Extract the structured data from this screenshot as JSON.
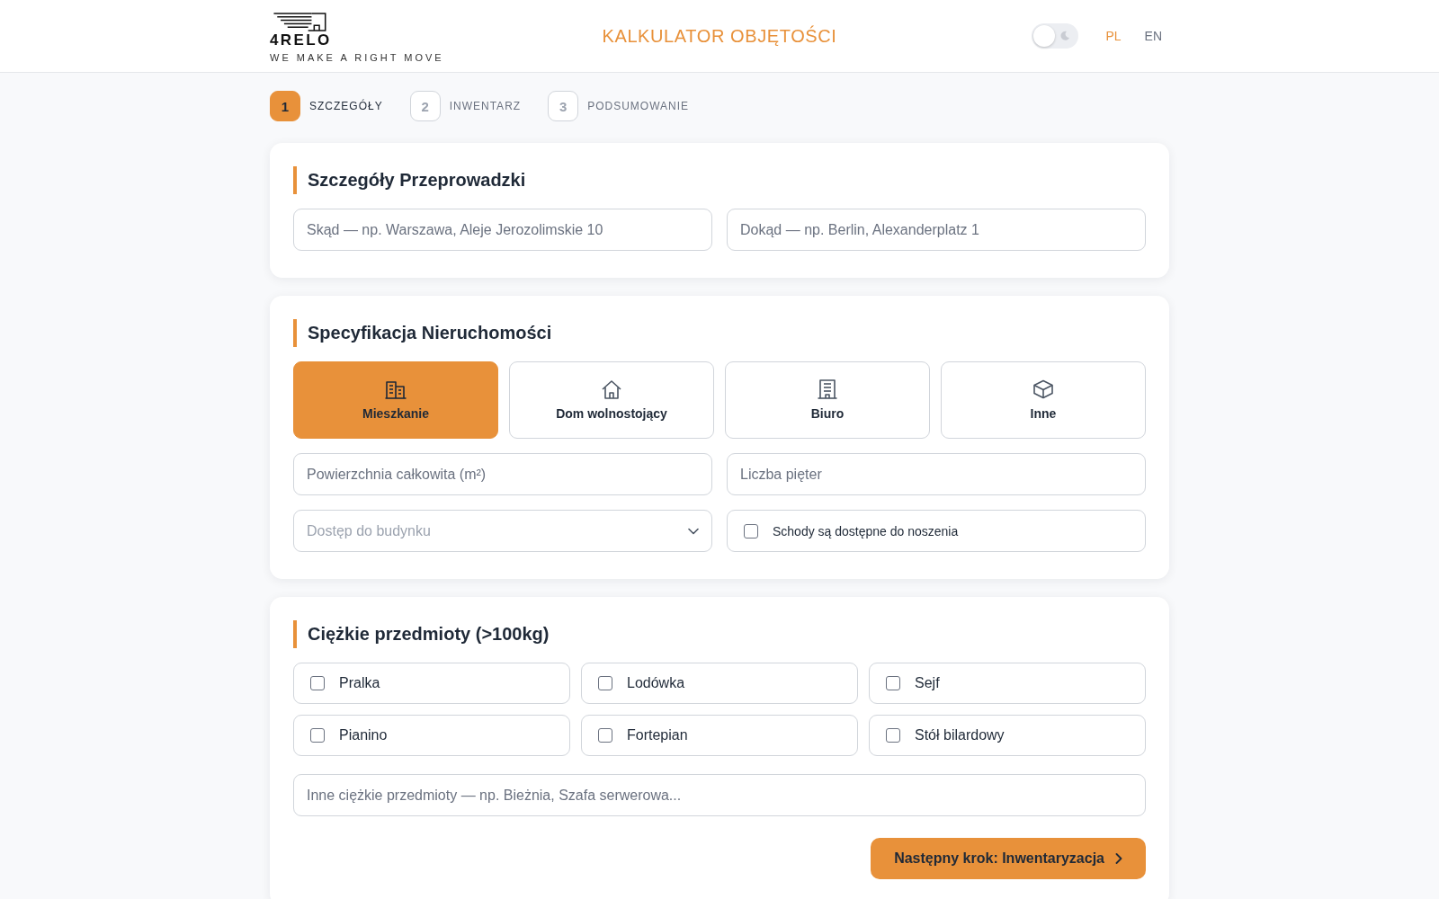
{
  "header": {
    "logo": {
      "wordmark": "4RELO",
      "tagline": "WE MAKE A RIGHT MOVE"
    },
    "title": "KALKULATOR OBJĘTOŚCI",
    "dark_mode_toggle": {
      "on": false
    },
    "languages": [
      {
        "label": "PL",
        "selected": true
      },
      {
        "label": "EN",
        "selected": false
      }
    ]
  },
  "steps": [
    {
      "number": "1",
      "label": "SZCZEGÓŁY",
      "selected": true
    },
    {
      "number": "2",
      "label": "INWENTARZ",
      "selected": false
    },
    {
      "number": "3",
      "label": "PODSUMOWANIE",
      "selected": false
    }
  ],
  "move_details": {
    "title": "Szczegóły Przeprowadzki",
    "from_field": {
      "placeholder": "Skąd — np. Warszawa, Aleje Jerozolimskie 10"
    },
    "to_field": {
      "placeholder": "Dokąd — np. Berlin, Alexanderplatz 1"
    }
  },
  "property": {
    "title": "Specyfikacja Nieruchomości",
    "types": [
      {
        "kind": "apartment",
        "label": "Mieszkanie",
        "selected": true
      },
      {
        "kind": "house",
        "label": "Dom wolnostojący",
        "selected": false
      },
      {
        "kind": "office",
        "label": "Biuro",
        "selected": false
      },
      {
        "kind": "other",
        "label": "Inne",
        "selected": false
      }
    ],
    "area_field": {
      "placeholder": "Powierzchnia całkowita (m²)"
    },
    "floors_field": {
      "placeholder": "Liczba pięter"
    },
    "access_select": {
      "placeholder": "Dostęp do budynku"
    },
    "stairs_option": {
      "label": "Schody są dostępne do noszenia",
      "checked": false
    }
  },
  "heavy_items": {
    "title": "Ciężkie przedmioty (>100kg)",
    "items": [
      {
        "label": "Pralka",
        "checked": false
      },
      {
        "label": "Lodówka",
        "checked": false
      },
      {
        "label": "Sejf",
        "checked": false
      },
      {
        "label": "Pianino",
        "checked": false
      },
      {
        "label": "Fortepian",
        "checked": false
      },
      {
        "label": "Stół bilardowy",
        "checked": false
      }
    ],
    "other_field": {
      "placeholder": "Inne ciężkie przedmioty — np. Bieżnia, Szafa serwerowa..."
    }
  },
  "next_button": {
    "label": "Następny krok: Inwentaryzacja"
  }
}
